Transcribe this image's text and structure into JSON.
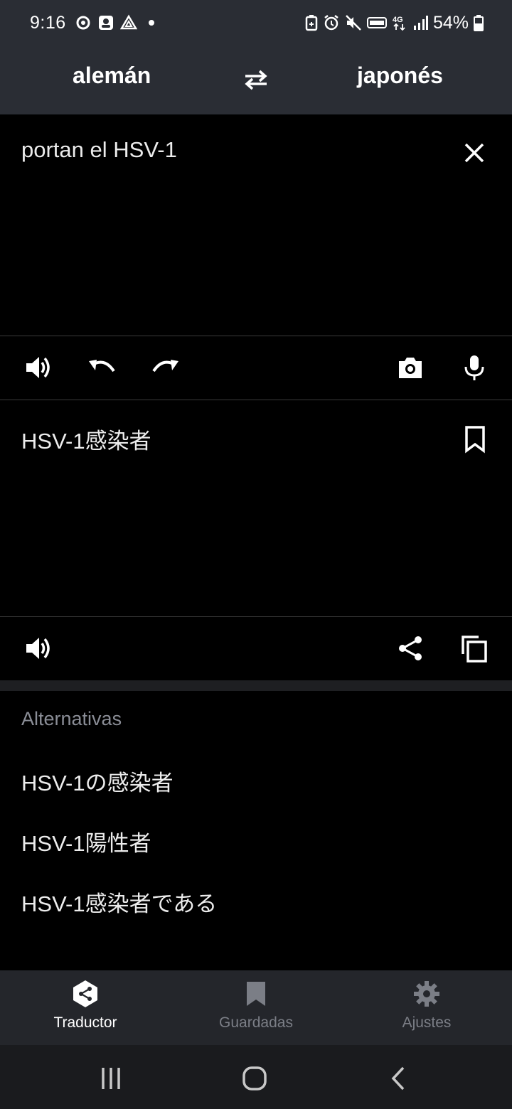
{
  "status_bar": {
    "time": "9:16",
    "battery_percent": "54%",
    "left_icons": [
      "sync-icon",
      "face-icon",
      "drive-icon",
      "dot-icon"
    ],
    "right_icons": [
      "battery-saver-icon",
      "alarm-icon",
      "mute-icon",
      "volte-icon",
      "network-4g-icon",
      "signal-icon",
      "battery-icon"
    ]
  },
  "language_bar": {
    "source_language": "alemán",
    "target_language": "japonés",
    "swap_icon": "swap-arrows-icon"
  },
  "source": {
    "text": "portan el HSV-1"
  },
  "target": {
    "text": "HSV-1感染者"
  },
  "alternatives": {
    "title": "Alternativas",
    "items": [
      "HSV-1の感染者",
      "HSV-1陽性者",
      "HSV-1感染者である"
    ]
  },
  "bottom_nav": {
    "items": [
      {
        "label": "Traductor",
        "icon": "deepl-logo-icon",
        "active": true
      },
      {
        "label": "Guardadas",
        "icon": "bookmark-icon",
        "active": false
      },
      {
        "label": "Ajustes",
        "icon": "gear-icon",
        "active": false
      }
    ]
  },
  "colors": {
    "header_bg": "#2a2d34",
    "body_bg": "#000000",
    "nav_bg": "#24262b",
    "muted_text": "#8a8d96"
  }
}
